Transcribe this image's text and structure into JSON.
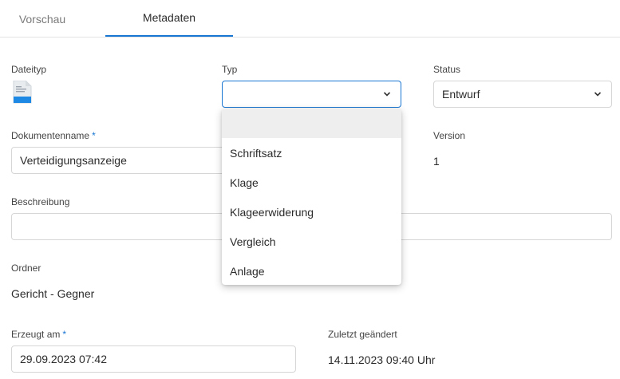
{
  "tabs": [
    {
      "label": "Vorschau",
      "active": false
    },
    {
      "label": "Metadaten",
      "active": true
    }
  ],
  "dateityp": {
    "label": "Dateityp",
    "icon": "document-file-icon"
  },
  "typ": {
    "label": "Typ",
    "value": ""
  },
  "status": {
    "label": "Status",
    "value": "Entwurf"
  },
  "dokumentenname": {
    "label": "Dokumentenname",
    "required_mark": "*",
    "value": "Verteidigungsanzeige"
  },
  "version": {
    "label": "Version",
    "value": "1"
  },
  "beschreibung": {
    "label": "Beschreibung",
    "value": ""
  },
  "ordner": {
    "label": "Ordner",
    "value": "Gericht - Gegner"
  },
  "erzeugt_am": {
    "label": "Erzeugt am",
    "required_mark": "*",
    "value": "29.09.2023 07:42"
  },
  "zuletzt_geaendert": {
    "label": "Zuletzt geändert",
    "value": "14.11.2023 09:40 Uhr"
  },
  "typ_dropdown": {
    "options": [
      "",
      "Schriftsatz",
      "Klage",
      "Klageerwiderung",
      "Vergleich",
      "Anlage"
    ]
  },
  "colors": {
    "accent": "#1976d2",
    "border": "#d6d6d6",
    "highlight": "#eeeeee"
  }
}
